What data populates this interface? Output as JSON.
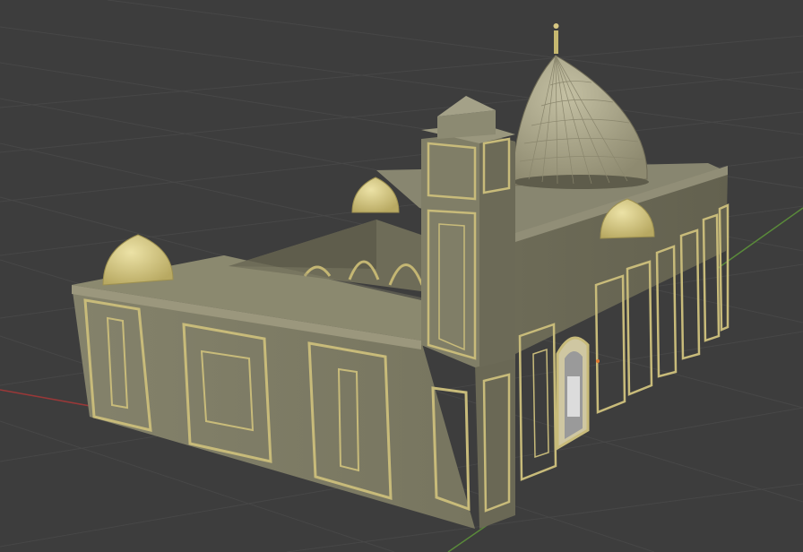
{
  "viewport": {
    "background": "#3d3d3d",
    "grid_color": "#4a4a4a",
    "x_axis_color": "#a03a3a",
    "y_axis_color": "#5a8a3a"
  },
  "model": {
    "subject": "mosque",
    "wall_color": "#7f7c65",
    "trim_color": "#c8bb7a",
    "dome_color": "#b3ae90"
  }
}
